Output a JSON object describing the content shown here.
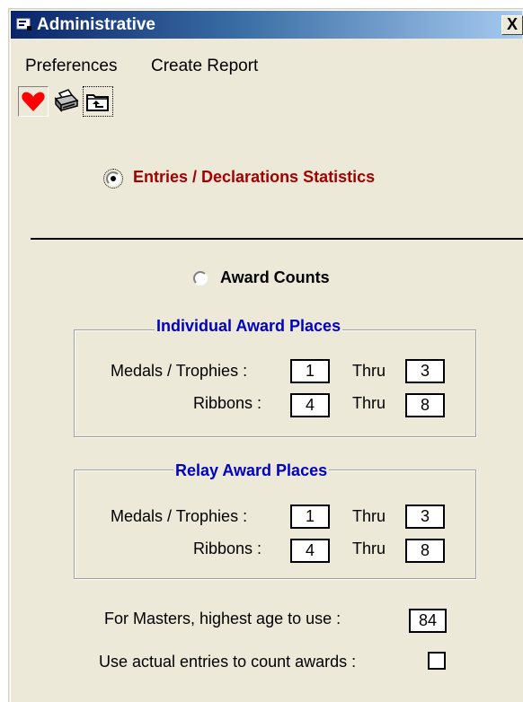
{
  "window": {
    "title": "Administrative",
    "close_glyph": "X"
  },
  "menu": [
    "Preferences",
    "Create Report"
  ],
  "toolbar": {
    "icons": [
      "heart-icon",
      "printer-icon",
      "folder-up-icon"
    ]
  },
  "options": {
    "entries": {
      "label": "Entries / Declarations Statistics",
      "selected": true,
      "color": "#a50000"
    },
    "awards": {
      "label": "Award Counts",
      "selected": false
    }
  },
  "individual": {
    "title": "Individual Award Places",
    "medals_label": "Medals / Trophies :",
    "medals_from": "1",
    "thru_label": "Thru",
    "medals_to": "3",
    "ribbons_label": "Ribbons :",
    "ribbons_from": "4",
    "ribbons_to": "8"
  },
  "relay": {
    "title": "Relay Award Places",
    "medals_label": "Medals / Trophies :",
    "medals_from": "1",
    "thru_label": "Thru",
    "medals_to": "3",
    "ribbons_label": "Ribbons :",
    "ribbons_from": "4",
    "ribbons_to": "8"
  },
  "masters": {
    "label": "For Masters, highest age to use :",
    "value": "84"
  },
  "actual_entries": {
    "label": "Use actual entries to count awards :",
    "checked": false
  }
}
